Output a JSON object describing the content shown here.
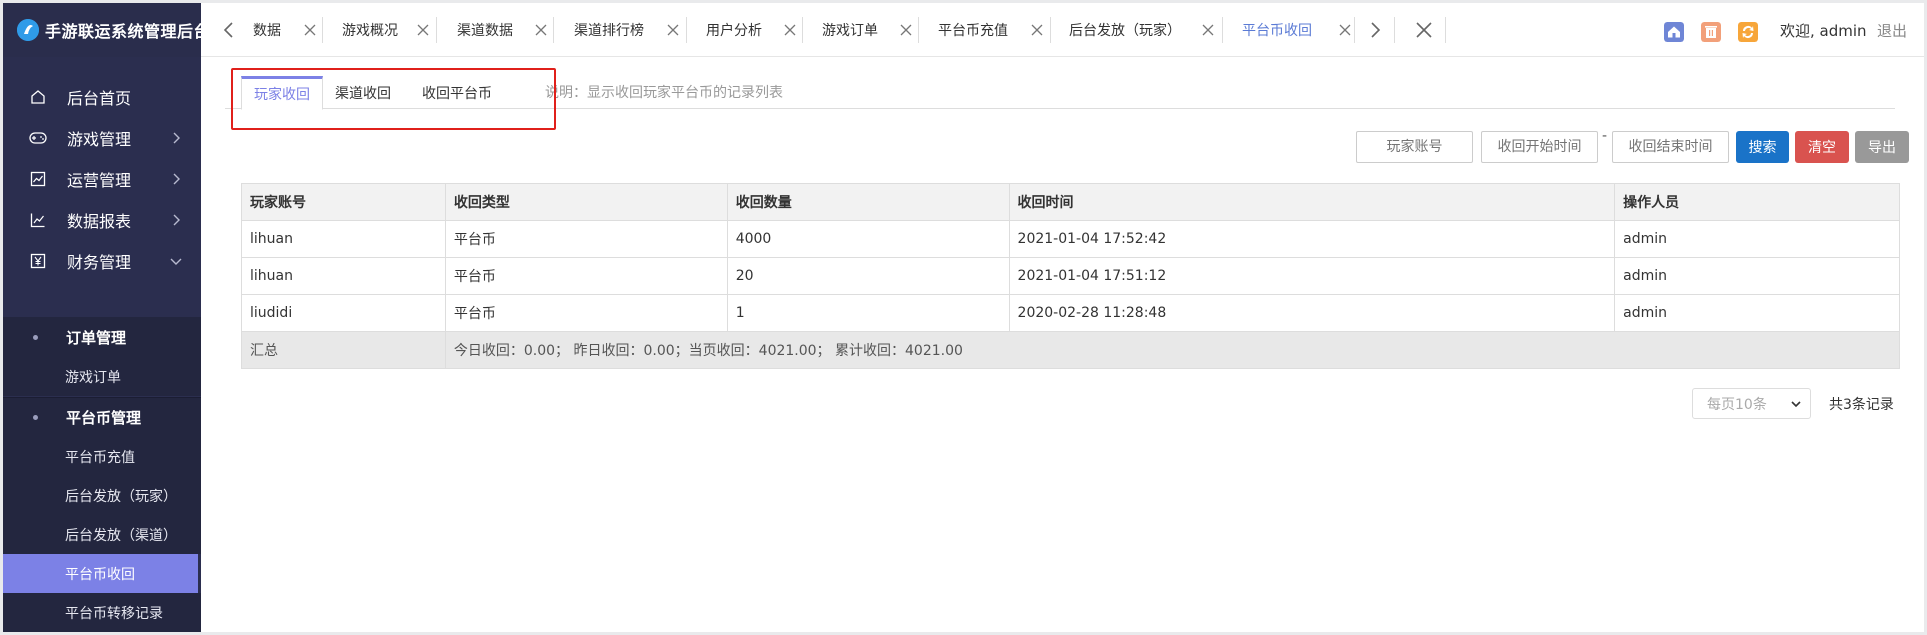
{
  "app": {
    "title": "手游联运系统管理后台"
  },
  "sidebar": {
    "menu": [
      {
        "label": "后台首页",
        "icon": "home-icon"
      },
      {
        "label": "游戏管理",
        "icon": "gamepad-icon"
      },
      {
        "label": "运营管理",
        "icon": "chart-box-icon"
      },
      {
        "label": "数据报表",
        "icon": "line-chart-icon"
      },
      {
        "label": "财务管理",
        "icon": "yuan-icon"
      }
    ],
    "groups": [
      {
        "label": "订单管理",
        "items": [
          {
            "label": "游戏订单"
          }
        ]
      },
      {
        "label": "平台币管理",
        "items": [
          {
            "label": "平台币充值"
          },
          {
            "label": "后台发放（玩家）"
          },
          {
            "label": "后台发放（渠道）"
          },
          {
            "label": "平台币收回",
            "active": true
          },
          {
            "label": "平台币转移记录"
          }
        ]
      }
    ]
  },
  "tabs": [
    {
      "label": "数据"
    },
    {
      "label": "游戏概况"
    },
    {
      "label": "渠道数据"
    },
    {
      "label": "渠道排行榜"
    },
    {
      "label": "用户分析"
    },
    {
      "label": "游戏订单"
    },
    {
      "label": "平台币充值"
    },
    {
      "label": "后台发放（玩家）"
    },
    {
      "label": "平台币收回",
      "active": true
    }
  ],
  "header": {
    "welcome": "欢迎, admin",
    "logout": "退出"
  },
  "subtabs": [
    {
      "label": "玩家收回",
      "active": true
    },
    {
      "label": "渠道收回"
    },
    {
      "label": "收回平台币"
    }
  ],
  "hint": "说明：显示收回玩家平台币的记录列表",
  "filters": {
    "account_placeholder": "玩家账号",
    "start_placeholder": "收回开始时间",
    "range_sep": "-",
    "end_placeholder": "收回结束时间",
    "search": "搜索",
    "clear": "清空",
    "export": "导出"
  },
  "table": {
    "headers": [
      "玩家账号",
      "收回类型",
      "收回数量",
      "收回时间",
      "操作人员"
    ],
    "rows": [
      [
        "lihuan",
        "平台币",
        "4000",
        "2021-01-04 17:52:42",
        "admin"
      ],
      [
        "lihuan",
        "平台币",
        "20",
        "2021-01-04 17:51:12",
        "admin"
      ],
      [
        "liudidi",
        "平台币",
        "1",
        "2020-02-28 11:28:48",
        "admin"
      ]
    ],
    "summary_label": "汇总",
    "summary_text": "今日收回：0.00；  昨日收回：0.00；当页收回：4021.00；  累计收回：4021.00"
  },
  "pager": {
    "per_page": "每页10条",
    "total": "共3条记录"
  },
  "colors": {
    "sidebar": "#2b2e4f",
    "accent": "#7c81e6",
    "search": "#1a73c8",
    "clear": "#d9534f",
    "export": "#999999",
    "highlight": "#e0201b"
  }
}
